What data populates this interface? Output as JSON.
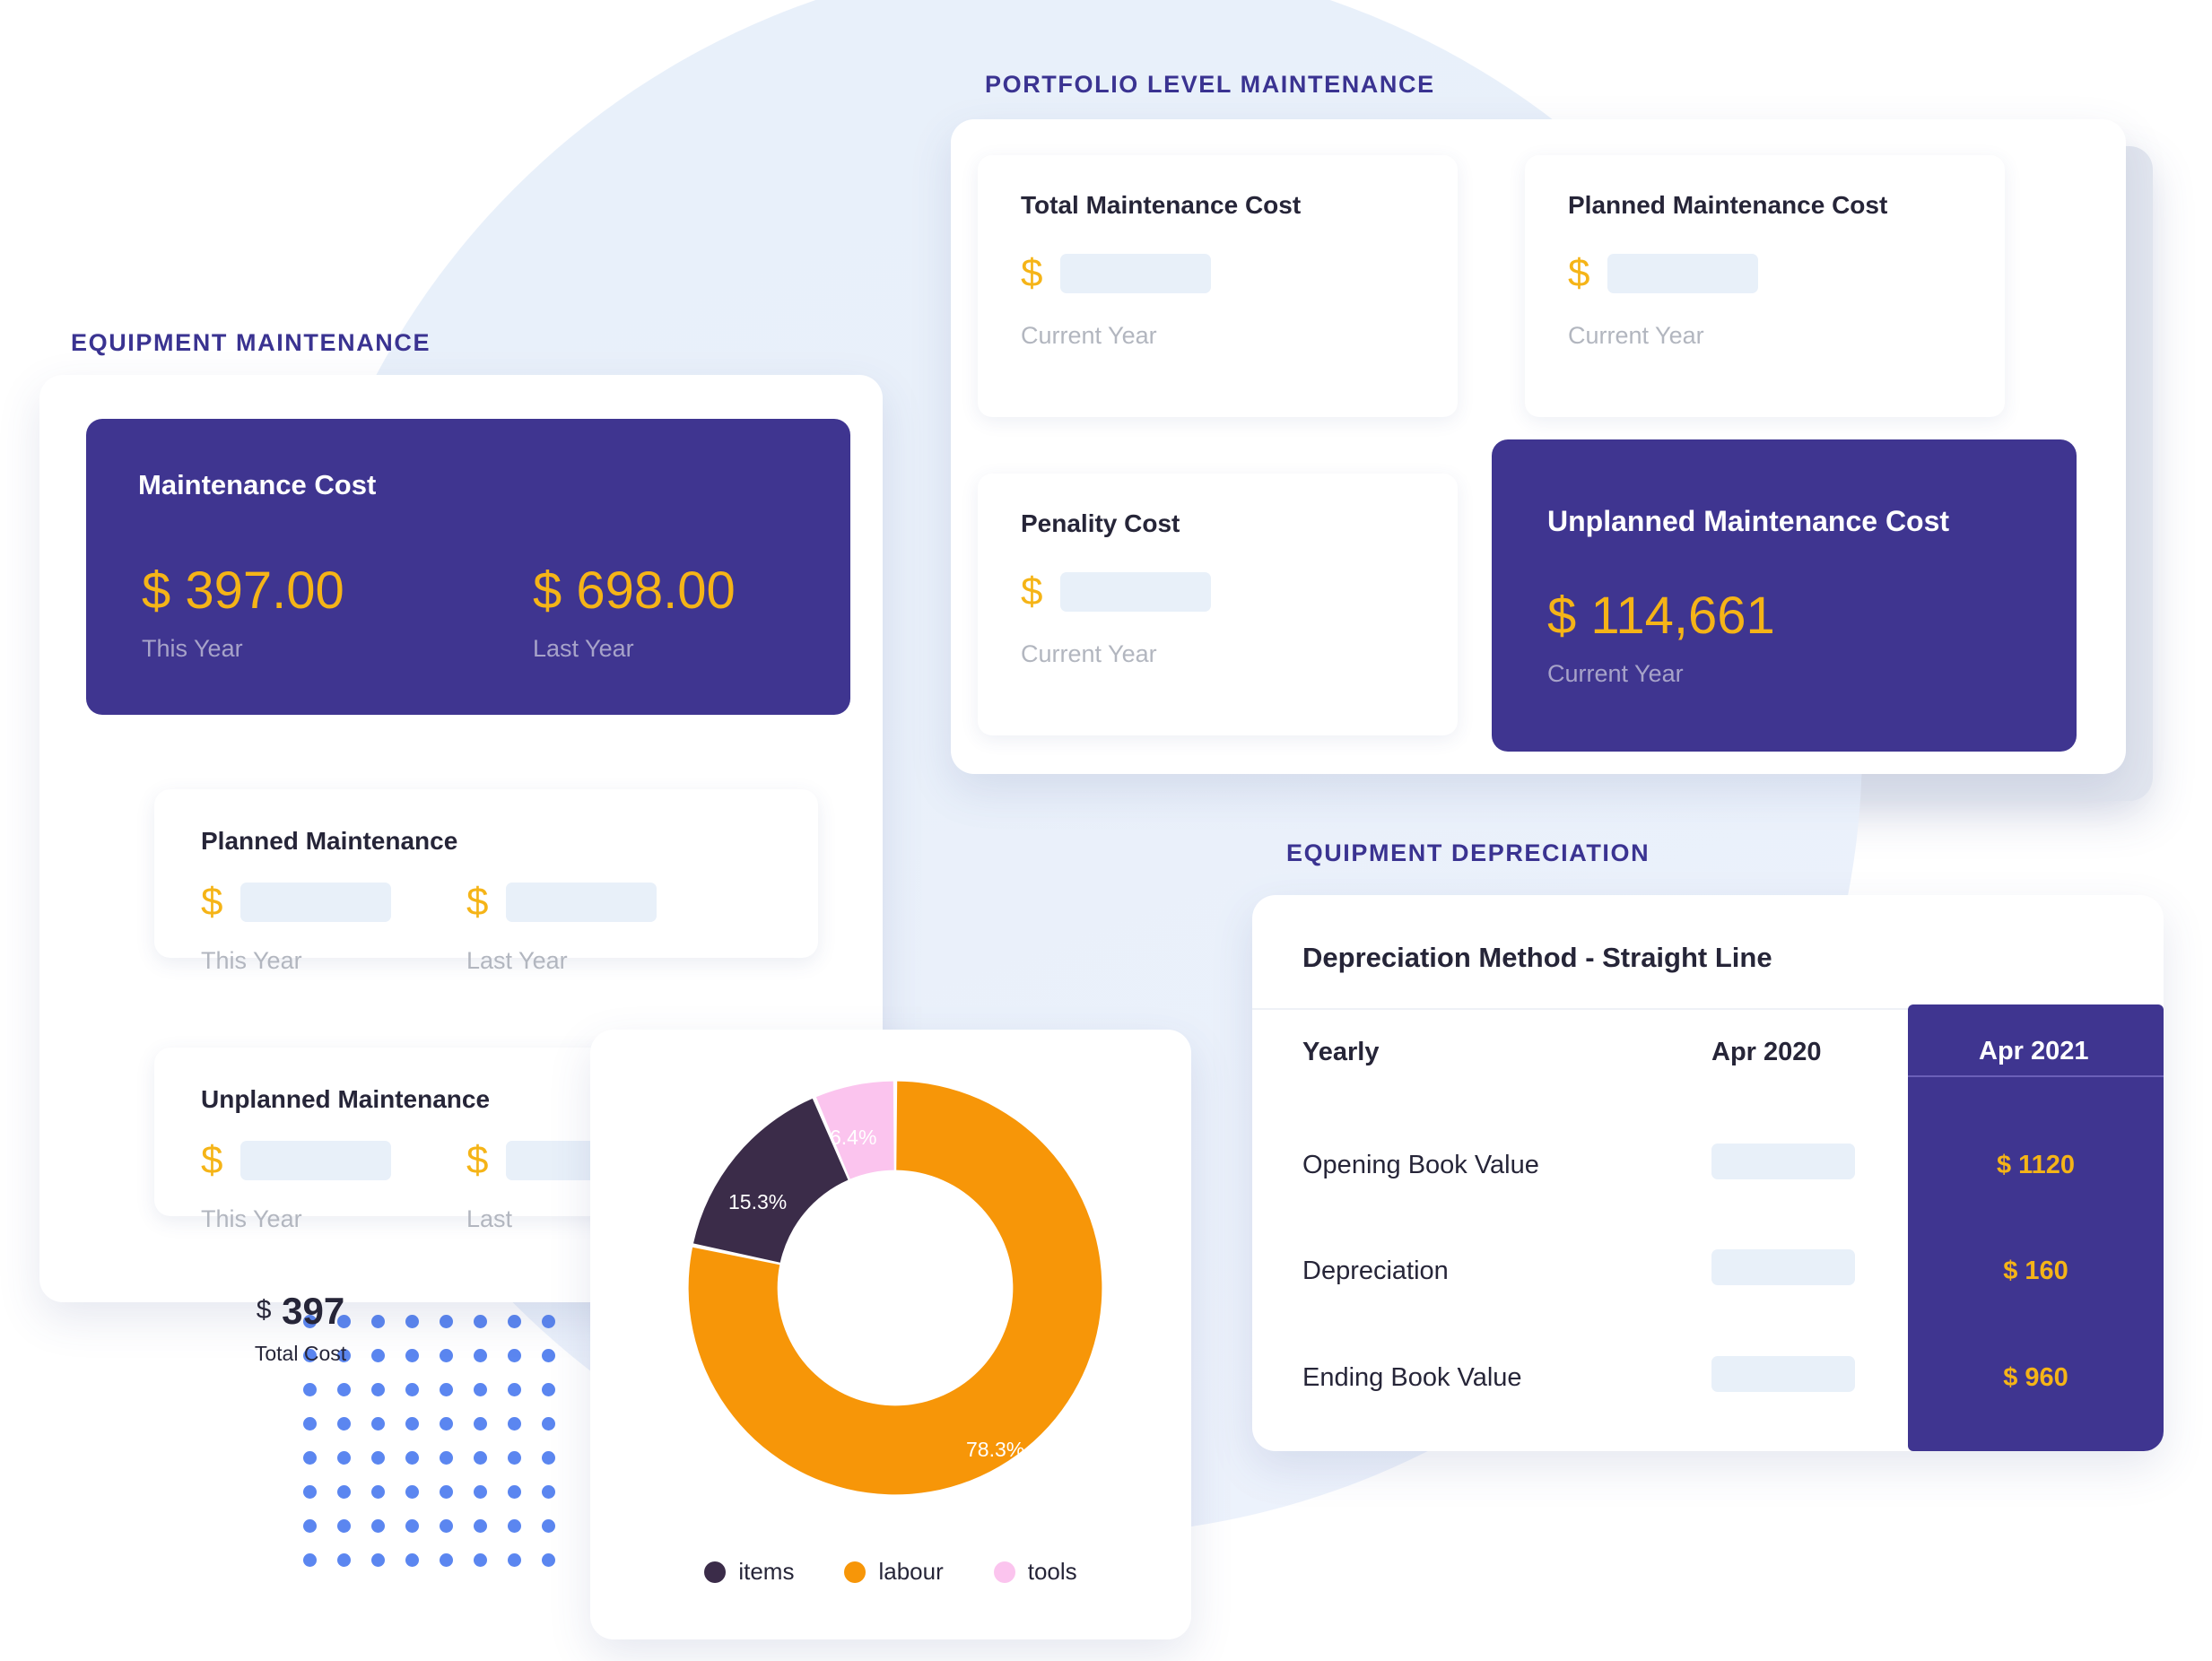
{
  "sections": {
    "equipment_maintenance_label": "EQUIPMENT MAINTENANCE",
    "portfolio_label": "PORTFOLIO LEVEL MAINTENANCE",
    "depreciation_label": "EQUIPMENT DEPRECIATION"
  },
  "colors": {
    "brand_purple": "#3f3590",
    "accent_yellow": "#f5b417",
    "label_purple": "#3a3391",
    "placeholder_blue": "#e8f0f9",
    "dot_blue": "#5b86f0"
  },
  "equipment_maintenance": {
    "main_card": {
      "title": "Maintenance Cost",
      "this_year": {
        "value": "$ 397.00",
        "caption": "This Year"
      },
      "last_year": {
        "value": "$ 698.00",
        "caption": "Last Year"
      }
    },
    "planned": {
      "title": "Planned Maintenance",
      "currency": "$",
      "this_year_caption": "This Year",
      "last_year_caption": "Last Year"
    },
    "unplanned": {
      "title": "Unplanned Maintenance",
      "currency": "$",
      "this_year_caption": "This Year",
      "last_year_caption": "Last"
    }
  },
  "portfolio": {
    "total_maintenance": {
      "title": "Total Maintenance Cost",
      "currency": "$",
      "caption": "Current Year"
    },
    "planned_maintenance": {
      "title": "Planned Maintenance Cost",
      "currency": "$",
      "caption": "Current Year"
    },
    "penality": {
      "title": "Penality Cost",
      "currency": "$",
      "caption": "Current Year"
    },
    "unplanned_maintenance": {
      "title": "Unplanned Maintenance Cost",
      "value": "$ 114,661",
      "caption": "Current Year"
    }
  },
  "depreciation": {
    "method": "Depreciation Method - Straight Line",
    "columns": [
      "Yearly",
      "Apr 2020",
      "Apr 2021"
    ],
    "rows": [
      {
        "label": "Opening Book Value",
        "apr2020": "",
        "apr2021": "$ 1120"
      },
      {
        "label": "Depreciation",
        "apr2020": "",
        "apr2021": "$ 160"
      },
      {
        "label": "Ending Book Value",
        "apr2020": "",
        "apr2021": "$ 960"
      }
    ]
  },
  "chart_data": {
    "type": "pie",
    "title": "",
    "center_currency": "$",
    "center_value": "397",
    "center_label": "Total Cost",
    "categories": [
      "items",
      "labour",
      "tools"
    ],
    "values": [
      15.3,
      78.3,
      6.4
    ],
    "value_labels": [
      "15.3%",
      "78.3%",
      "6.4%"
    ],
    "colors": [
      "#3b2c49",
      "#f79608",
      "#fbc4ee"
    ],
    "legend": [
      {
        "name": "items",
        "color": "#3b2c49"
      },
      {
        "name": "labour",
        "color": "#f79608"
      },
      {
        "name": "tools",
        "color": "#fbc4ee"
      }
    ],
    "legend_position": "bottom",
    "donut": true,
    "inner_radius_ratio": 0.57,
    "grid": false
  }
}
